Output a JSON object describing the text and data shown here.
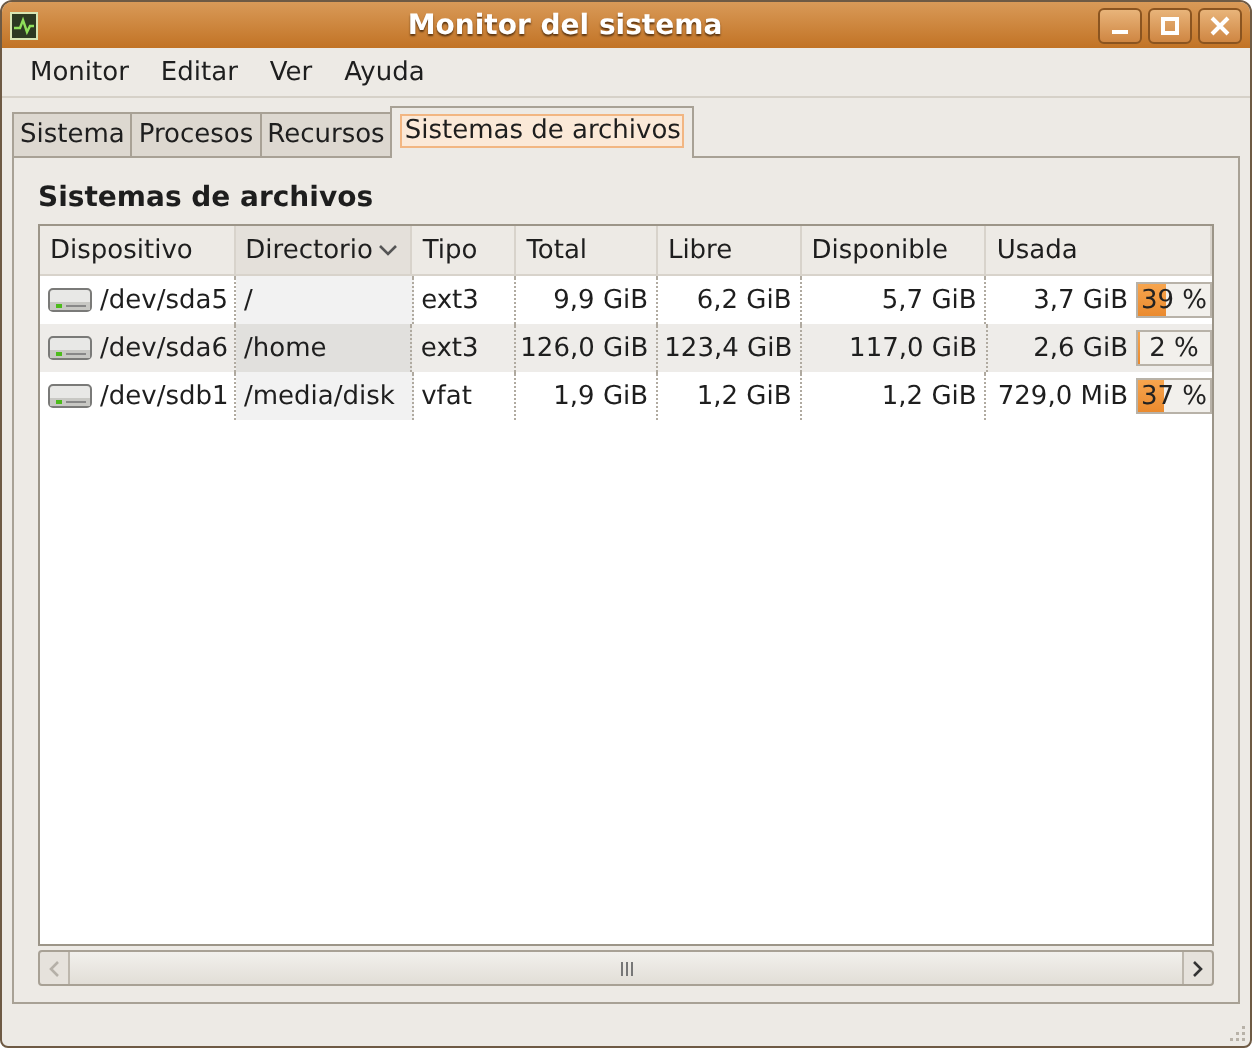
{
  "window": {
    "title": "Monitor del sistema"
  },
  "menu": [
    "Monitor",
    "Editar",
    "Ver",
    "Ayuda"
  ],
  "tabs": [
    {
      "label": "Sistema",
      "selected": false
    },
    {
      "label": "Procesos",
      "selected": false
    },
    {
      "label": "Recursos",
      "selected": false
    },
    {
      "label": "Sistemas de archivos",
      "selected": true
    }
  ],
  "heading": "Sistemas de archivos",
  "table": {
    "columns": [
      {
        "label": "Dispositivo",
        "sorted": false
      },
      {
        "label": "Directorio",
        "sorted": true
      },
      {
        "label": "Tipo",
        "sorted": false
      },
      {
        "label": "Total",
        "sorted": false
      },
      {
        "label": "Libre",
        "sorted": false
      },
      {
        "label": "Disponible",
        "sorted": false
      },
      {
        "label": "Usada",
        "sorted": false
      }
    ],
    "rows": [
      {
        "cells": [
          "/dev/sda5",
          "/",
          "ext3",
          "9,9 GiB",
          "6,2 GiB",
          "5,7 GiB",
          "3,7 GiB"
        ],
        "usage": {
          "text": "39 %",
          "level": 0.39
        }
      },
      {
        "cells": [
          "/dev/sda6",
          "/home",
          "ext3",
          "126,0 GiB",
          "123,4 GiB",
          "117,0 GiB",
          "2,6 GiB"
        ],
        "usage": {
          "text": "2 %",
          "level": 0.02
        }
      },
      {
        "cells": [
          "/dev/sdb1",
          "/media/disk",
          "vfat",
          "1,9 GiB",
          "1,2 GiB",
          "1,2 GiB",
          "729,0 MiB"
        ],
        "usage": {
          "text": "37 %",
          "level": 0.37
        }
      }
    ]
  }
}
